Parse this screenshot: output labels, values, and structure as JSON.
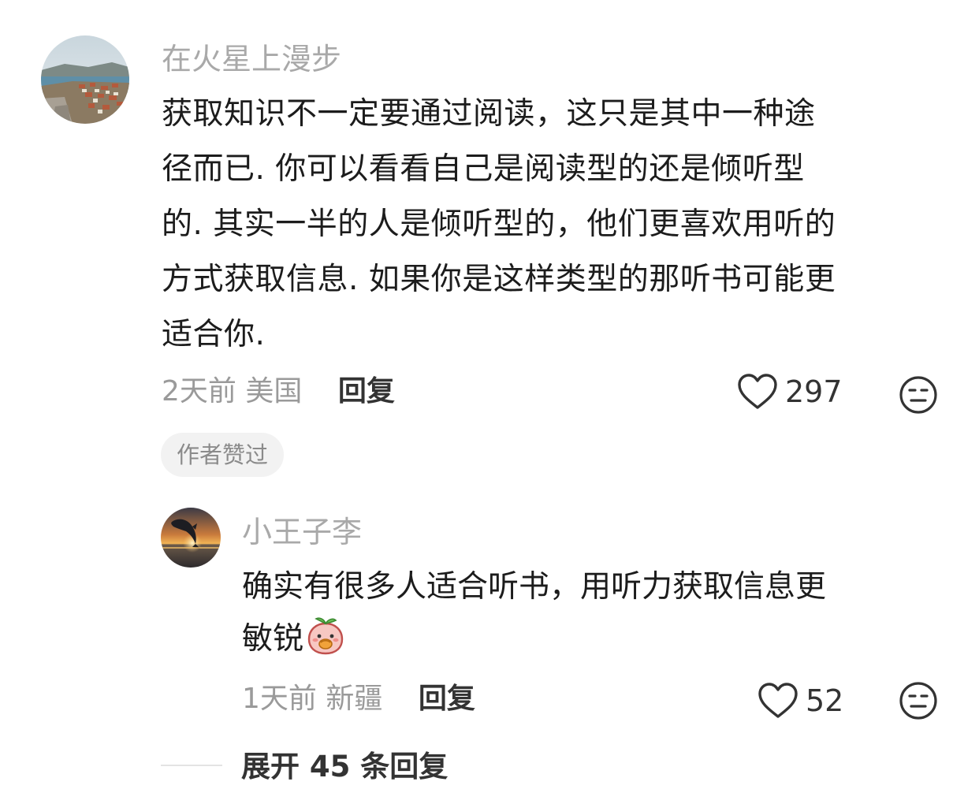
{
  "comment": {
    "username": "在火星上漫步",
    "avatar_icon": "landscape-avatar",
    "text_lines": [
      "获取知识不一定要通过阅读，这只是其中一种途",
      "径而已. 你可以看看自己是阅读型的还是倾听型",
      "的. 其实一半的人是倾听型的，他们更喜欢用听的",
      "方式获取信息. 如果你是这样类型的那听书可能更",
      "适合你."
    ],
    "time": "2天前",
    "location": "美国",
    "reply_label": "回复",
    "like_count": "297",
    "author_badge": "作者赞过"
  },
  "reply": {
    "username": "小王子李",
    "avatar_icon": "dolphin-sunset-avatar",
    "text_lines": [
      "确实有很多人适合听书，用听力获取信息更",
      "敏锐"
    ],
    "emoji_icon": "peach-eating-emoji",
    "time": "1天前",
    "location": "新疆",
    "reply_label": "回复",
    "like_count": "52"
  },
  "expand": {
    "label": "展开 45 条回复"
  },
  "icons": {
    "like": "heart-outline-icon",
    "dislike": "neutral-face-icon"
  },
  "colors": {
    "username": "#a9a9a9",
    "text": "#1c1c1c",
    "meta": "#9a9a9a",
    "badge_bg": "#f2f2f2"
  }
}
